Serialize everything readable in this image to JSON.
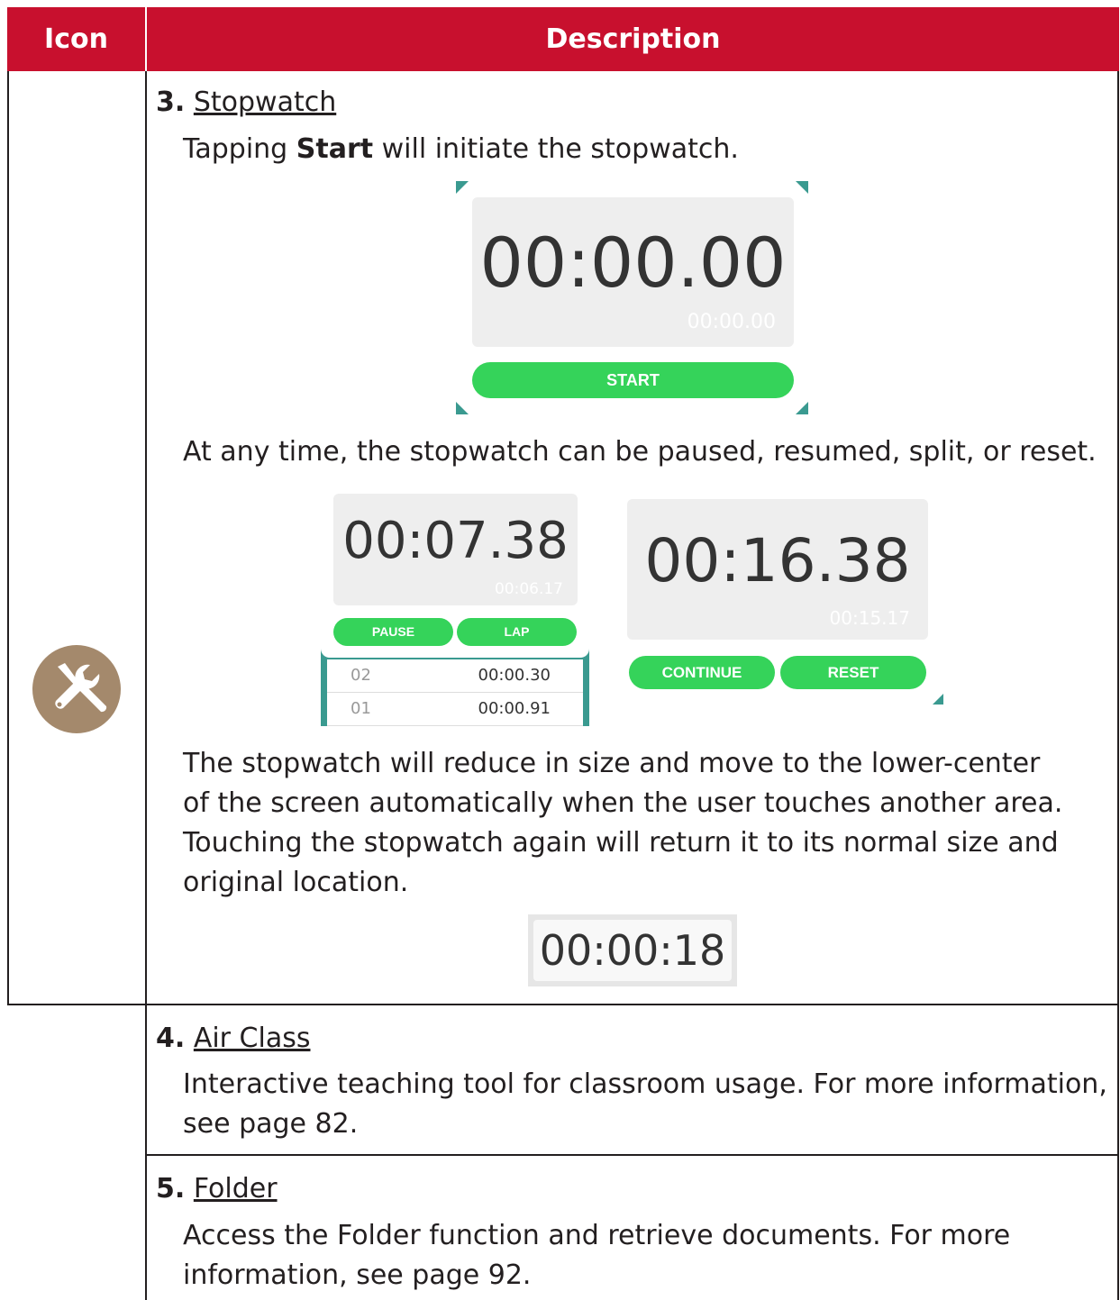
{
  "table": {
    "header_icon": "Icon",
    "header_description": "Description"
  },
  "row_icon": "tools-icon",
  "items": [
    {
      "number": "3.",
      "name": "Stopwatch",
      "intro_pre": "Tapping ",
      "intro_bold": "Start",
      "intro_post": " will initiate the stopwatch.",
      "paused_text": "At any time, the stopwatch can be paused, resumed, split, or reset.",
      "shrink_text": [
        "The stopwatch will reduce in size and move to the lower-center",
        "of the screen automatically when the user touches another area.",
        "Touching the stopwatch again will return it to its normal size and",
        "original location."
      ]
    },
    {
      "number": "4.",
      "name": "Air Class",
      "desc": [
        "Interactive teaching tool for classroom usage. For more information,",
        "see page 82."
      ]
    },
    {
      "number": "5.",
      "name": "Folder",
      "desc": [
        "Access the Folder function and retrieve documents. For more",
        "information, see page 92."
      ]
    }
  ],
  "stopwatch_start": {
    "time": "00:00.00",
    "sub": "00:00.00",
    "button": "START"
  },
  "stopwatch_running": {
    "time": "00:07.38",
    "sub": "00:06.17",
    "pause": "PAUSE",
    "lap": "LAP",
    "laps": [
      {
        "idx": "02",
        "val": "00:00.30"
      },
      {
        "idx": "01",
        "val": "00:00.91"
      }
    ]
  },
  "stopwatch_paused": {
    "time": "00:16.38",
    "sub": "00:15.17",
    "continue": "CONTINUE",
    "reset": "RESET"
  },
  "stopwatch_mini": {
    "time": "00:00:18"
  },
  "colors": {
    "header": "#c8102e",
    "icon_bg": "#a4896c",
    "button": "#35d35a",
    "teal": "#3a9a90"
  }
}
